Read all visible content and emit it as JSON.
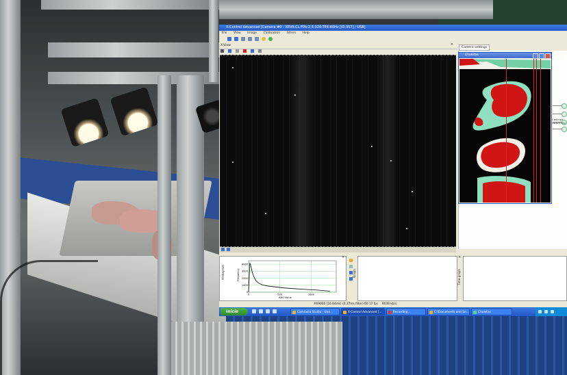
{
  "window": {
    "title": "X-Control Advanced [Camera #0 - XEVA-CL-FPA-2.5-320-TE4-60Hz [ID:357] / USB]",
    "menu": [
      "File",
      "View",
      "Image",
      "Calibration",
      "Filters",
      "Help"
    ]
  },
  "xview": {
    "caption": "X-View",
    "close": "✕"
  },
  "camera_settings": {
    "tab_label": "Camera settings",
    "snippet_lines": [
      "al (Cooling)",
      "hardware trig"
    ]
  },
  "child_window": {
    "title": "Chuletas"
  },
  "graph": {
    "side_label": "Histogram",
    "y_label": "Frequency",
    "x_label": "ADU Value",
    "y_ticks": [
      "4000",
      "3000",
      "2000",
      "1000",
      "0"
    ],
    "x_ticks": [
      "0",
      "500",
      "1000"
    ],
    "chart_data": {
      "type": "line",
      "x": [
        0,
        20,
        40,
        60,
        90,
        120,
        160,
        220,
        300,
        420,
        560,
        700,
        900,
        1100,
        1300
      ],
      "y": [
        0,
        4200,
        3600,
        2800,
        2100,
        1600,
        1300,
        1050,
        900,
        760,
        620,
        520,
        400,
        300,
        150
      ],
      "xlim": [
        0,
        1400
      ],
      "ylim": [
        0,
        4500
      ],
      "grid": true
    }
  },
  "second_panel": {
    "label": "Graph"
  },
  "third_panel": {
    "label": "Time graph"
  },
  "statusbar": {
    "frame": "#69006 (16.64ms) (0.37ms filter)",
    "fps": "60.17 fps",
    "kbits": "9638 kb/s"
  },
  "taskbar": {
    "start_label": "Inicio",
    "tasks": [
      "Camtasia Studio - Unn...",
      "X-Control Advanced [...",
      "Recording...",
      "C:\\Documents and Se...",
      "Chuletas"
    ]
  }
}
